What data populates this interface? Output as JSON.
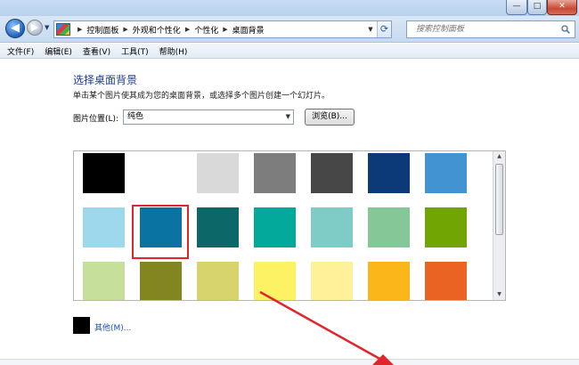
{
  "window": {
    "minimize_label": "—",
    "maximize_label": "□",
    "close_label": "✕"
  },
  "nav": {
    "back_glyph": "◀",
    "forward_glyph": "▶",
    "dropdown_glyph": "▼",
    "breadcrumb": [
      "控制面板",
      "外观和个性化",
      "个性化",
      "桌面背景"
    ],
    "separator_glyph": "▶",
    "refresh_glyph": "⟳"
  },
  "search": {
    "placeholder": "搜索控制面板"
  },
  "menu": {
    "items": [
      "文件(F)",
      "编辑(E)",
      "查看(V)",
      "工具(T)",
      "帮助(H)"
    ]
  },
  "page": {
    "heading": "选择桌面背景",
    "subtitle": "单击某个图片使其成为您的桌面背景，或选择多个图片创建一个幻灯片。",
    "location_label": "图片位置(L):",
    "location_value": "纯色",
    "browse_label": "浏览(B)...",
    "other_label": "其他(M)..."
  },
  "colors": {
    "row1": [
      "#000000",
      "#ffffff",
      "#d9d9d9",
      "#7d7d7d",
      "#474747",
      "#0c3a78",
      "#4193d2"
    ],
    "row2": [
      "#9ed8ec",
      "#0a73a2",
      "#0b6768",
      "#03a99a",
      "#7fcbc5",
      "#85c796",
      "#71a504"
    ],
    "row3": [
      "#c6df9a",
      "#838521",
      "#d7d46d",
      "#fdf264",
      "#fdf29a",
      "#fbb61a",
      "#ea6323"
    ],
    "selected": "#0a73a2",
    "highlight": "#e0262a",
    "other_swatch": "#000000"
  }
}
